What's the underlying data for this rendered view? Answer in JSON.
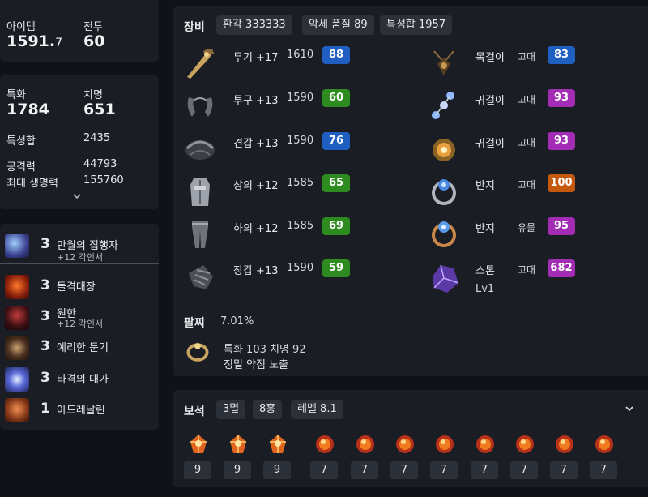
{
  "stats": {
    "item_level_label": "아이템",
    "item_level_main": "1591.",
    "item_level_decimal": "7",
    "combat_label": "전투",
    "combat_value": "60",
    "spec_label": "특화",
    "spec_value": "1784",
    "crit_label": "치명",
    "crit_value": "651",
    "total_stat_label": "특성합",
    "total_stat_value": "2435",
    "attack_label": "공격력",
    "attack_value": "44793",
    "hp_label": "최대 생명력",
    "hp_value": "155760"
  },
  "engravings": [
    {
      "level": "3",
      "name": "만월의 집행자",
      "sub": "+12 각인서",
      "icon": "moon-executor-icon"
    },
    {
      "level": "3",
      "name": "돌격대장",
      "sub": "",
      "icon": "charge-captain-icon"
    },
    {
      "level": "3",
      "name": "원한",
      "sub": "+12 각인서",
      "icon": "grudge-icon"
    },
    {
      "level": "3",
      "name": "예리한 둔기",
      "sub": "",
      "icon": "keen-blunt-icon"
    },
    {
      "level": "3",
      "name": "타격의 대가",
      "sub": "",
      "icon": "hit-master-icon"
    },
    {
      "level": "1",
      "name": "아드레날린",
      "sub": "",
      "icon": "adrenaline-icon"
    }
  ],
  "equipment": {
    "title": "장비",
    "chips": [
      "환각 333333",
      "악세 품질 89",
      "특성합 1957"
    ],
    "gear": [
      {
        "name": "무기 +17",
        "level": "1610",
        "quality": "88",
        "color": "blue",
        "icon": "weapon-icon"
      },
      {
        "name": "투구 +13",
        "level": "1590",
        "quality": "60",
        "color": "green",
        "icon": "helmet-icon"
      },
      {
        "name": "견갑 +13",
        "level": "1590",
        "quality": "76",
        "color": "blue",
        "icon": "shoulder-icon"
      },
      {
        "name": "상의 +12",
        "level": "1585",
        "quality": "65",
        "color": "green",
        "icon": "chest-icon"
      },
      {
        "name": "하의 +12",
        "level": "1585",
        "quality": "69",
        "color": "green",
        "icon": "pants-icon"
      },
      {
        "name": "장갑 +13",
        "level": "1590",
        "quality": "59",
        "color": "green",
        "icon": "gloves-icon"
      }
    ],
    "accessories": [
      {
        "name": "목걸이",
        "tier": "고대",
        "quality": "83",
        "color": "blue",
        "icon": "necklace-icon"
      },
      {
        "name": "귀걸이",
        "tier": "고대",
        "quality": "93",
        "color": "purple",
        "icon": "earring-icon"
      },
      {
        "name": "귀걸이",
        "tier": "고대",
        "quality": "93",
        "color": "purple",
        "icon": "earring-icon"
      },
      {
        "name": "반지",
        "tier": "고대",
        "quality": "100",
        "color": "orange",
        "icon": "ring-icon"
      },
      {
        "name": "반지",
        "tier": "유물",
        "quality": "95",
        "color": "purple",
        "icon": "ring-icon"
      },
      {
        "name": "스톤",
        "tier": "고대",
        "quality": "682",
        "color": "purple",
        "icon": "stone-icon",
        "sub": "Lv1"
      }
    ],
    "bracelet": {
      "title": "팔찌",
      "percent": "7.01%",
      "line1": "특화 103  치명 92",
      "line2": "정밀  약점 노출"
    }
  },
  "gems": {
    "title": "보석",
    "chips": [
      "3멸",
      "8홍",
      "레벨 8.1"
    ],
    "items": [
      {
        "level": "9",
        "type": "annihilation"
      },
      {
        "level": "9",
        "type": "annihilation"
      },
      {
        "level": "9",
        "type": "annihilation"
      },
      {
        "level": "7",
        "type": "crimson"
      },
      {
        "level": "7",
        "type": "crimson"
      },
      {
        "level": "7",
        "type": "crimson"
      },
      {
        "level": "7",
        "type": "crimson"
      },
      {
        "level": "7",
        "type": "crimson"
      },
      {
        "level": "7",
        "type": "crimson"
      },
      {
        "level": "7",
        "type": "crimson"
      },
      {
        "level": "7",
        "type": "crimson"
      }
    ]
  },
  "colors": {
    "green": "#2e8b1f",
    "blue": "#1f5fc2",
    "purple": "#a22db4",
    "orange": "#c55a0f"
  }
}
